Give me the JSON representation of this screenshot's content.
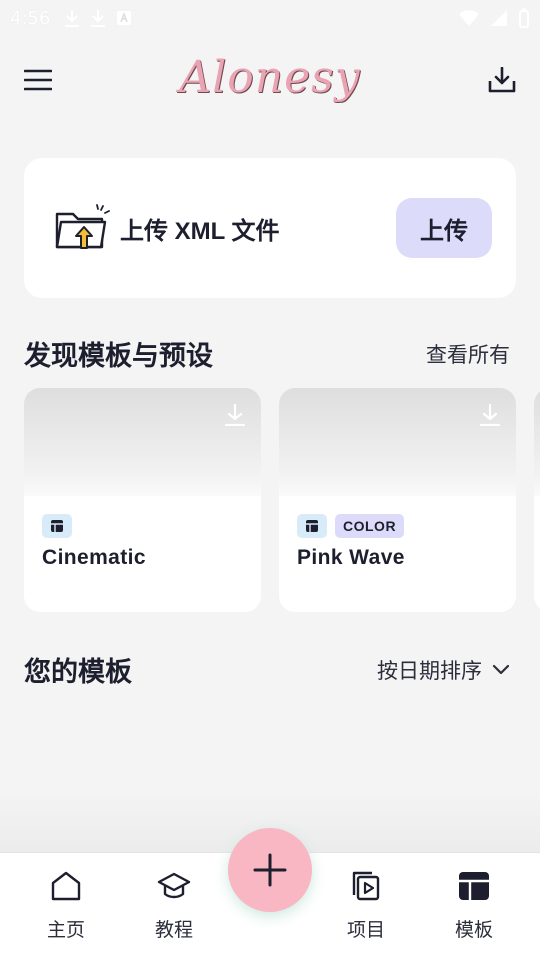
{
  "status_bar": {
    "time": "4:56"
  },
  "app_bar": {
    "logo_text": "Alonesy"
  },
  "upload_card": {
    "label": "上传 XML 文件",
    "button_label": "上传"
  },
  "discover": {
    "title": "发现模板与预设",
    "view_all": "查看所有",
    "cards": [
      {
        "name": "Cinematic",
        "tags": []
      },
      {
        "name": "Pink Wave",
        "tags": [
          "COLOR"
        ]
      }
    ]
  },
  "your_templates": {
    "title": "您的模板",
    "sort_label": "按日期排序"
  },
  "bottom_nav": {
    "items": [
      {
        "label": "主页",
        "icon": "home-icon"
      },
      {
        "label": "教程",
        "icon": "graduation-cap-icon"
      },
      {
        "label": "项目",
        "icon": "video-project-icon"
      },
      {
        "label": "模板",
        "icon": "template-icon"
      }
    ]
  },
  "colors": {
    "background": "#f4f4f4",
    "accent_fab": "#f9b6c3",
    "upload_button": "#dcdcfa",
    "tag_icon_bg": "#d8ebf8",
    "logo": "#e9a3b2"
  }
}
